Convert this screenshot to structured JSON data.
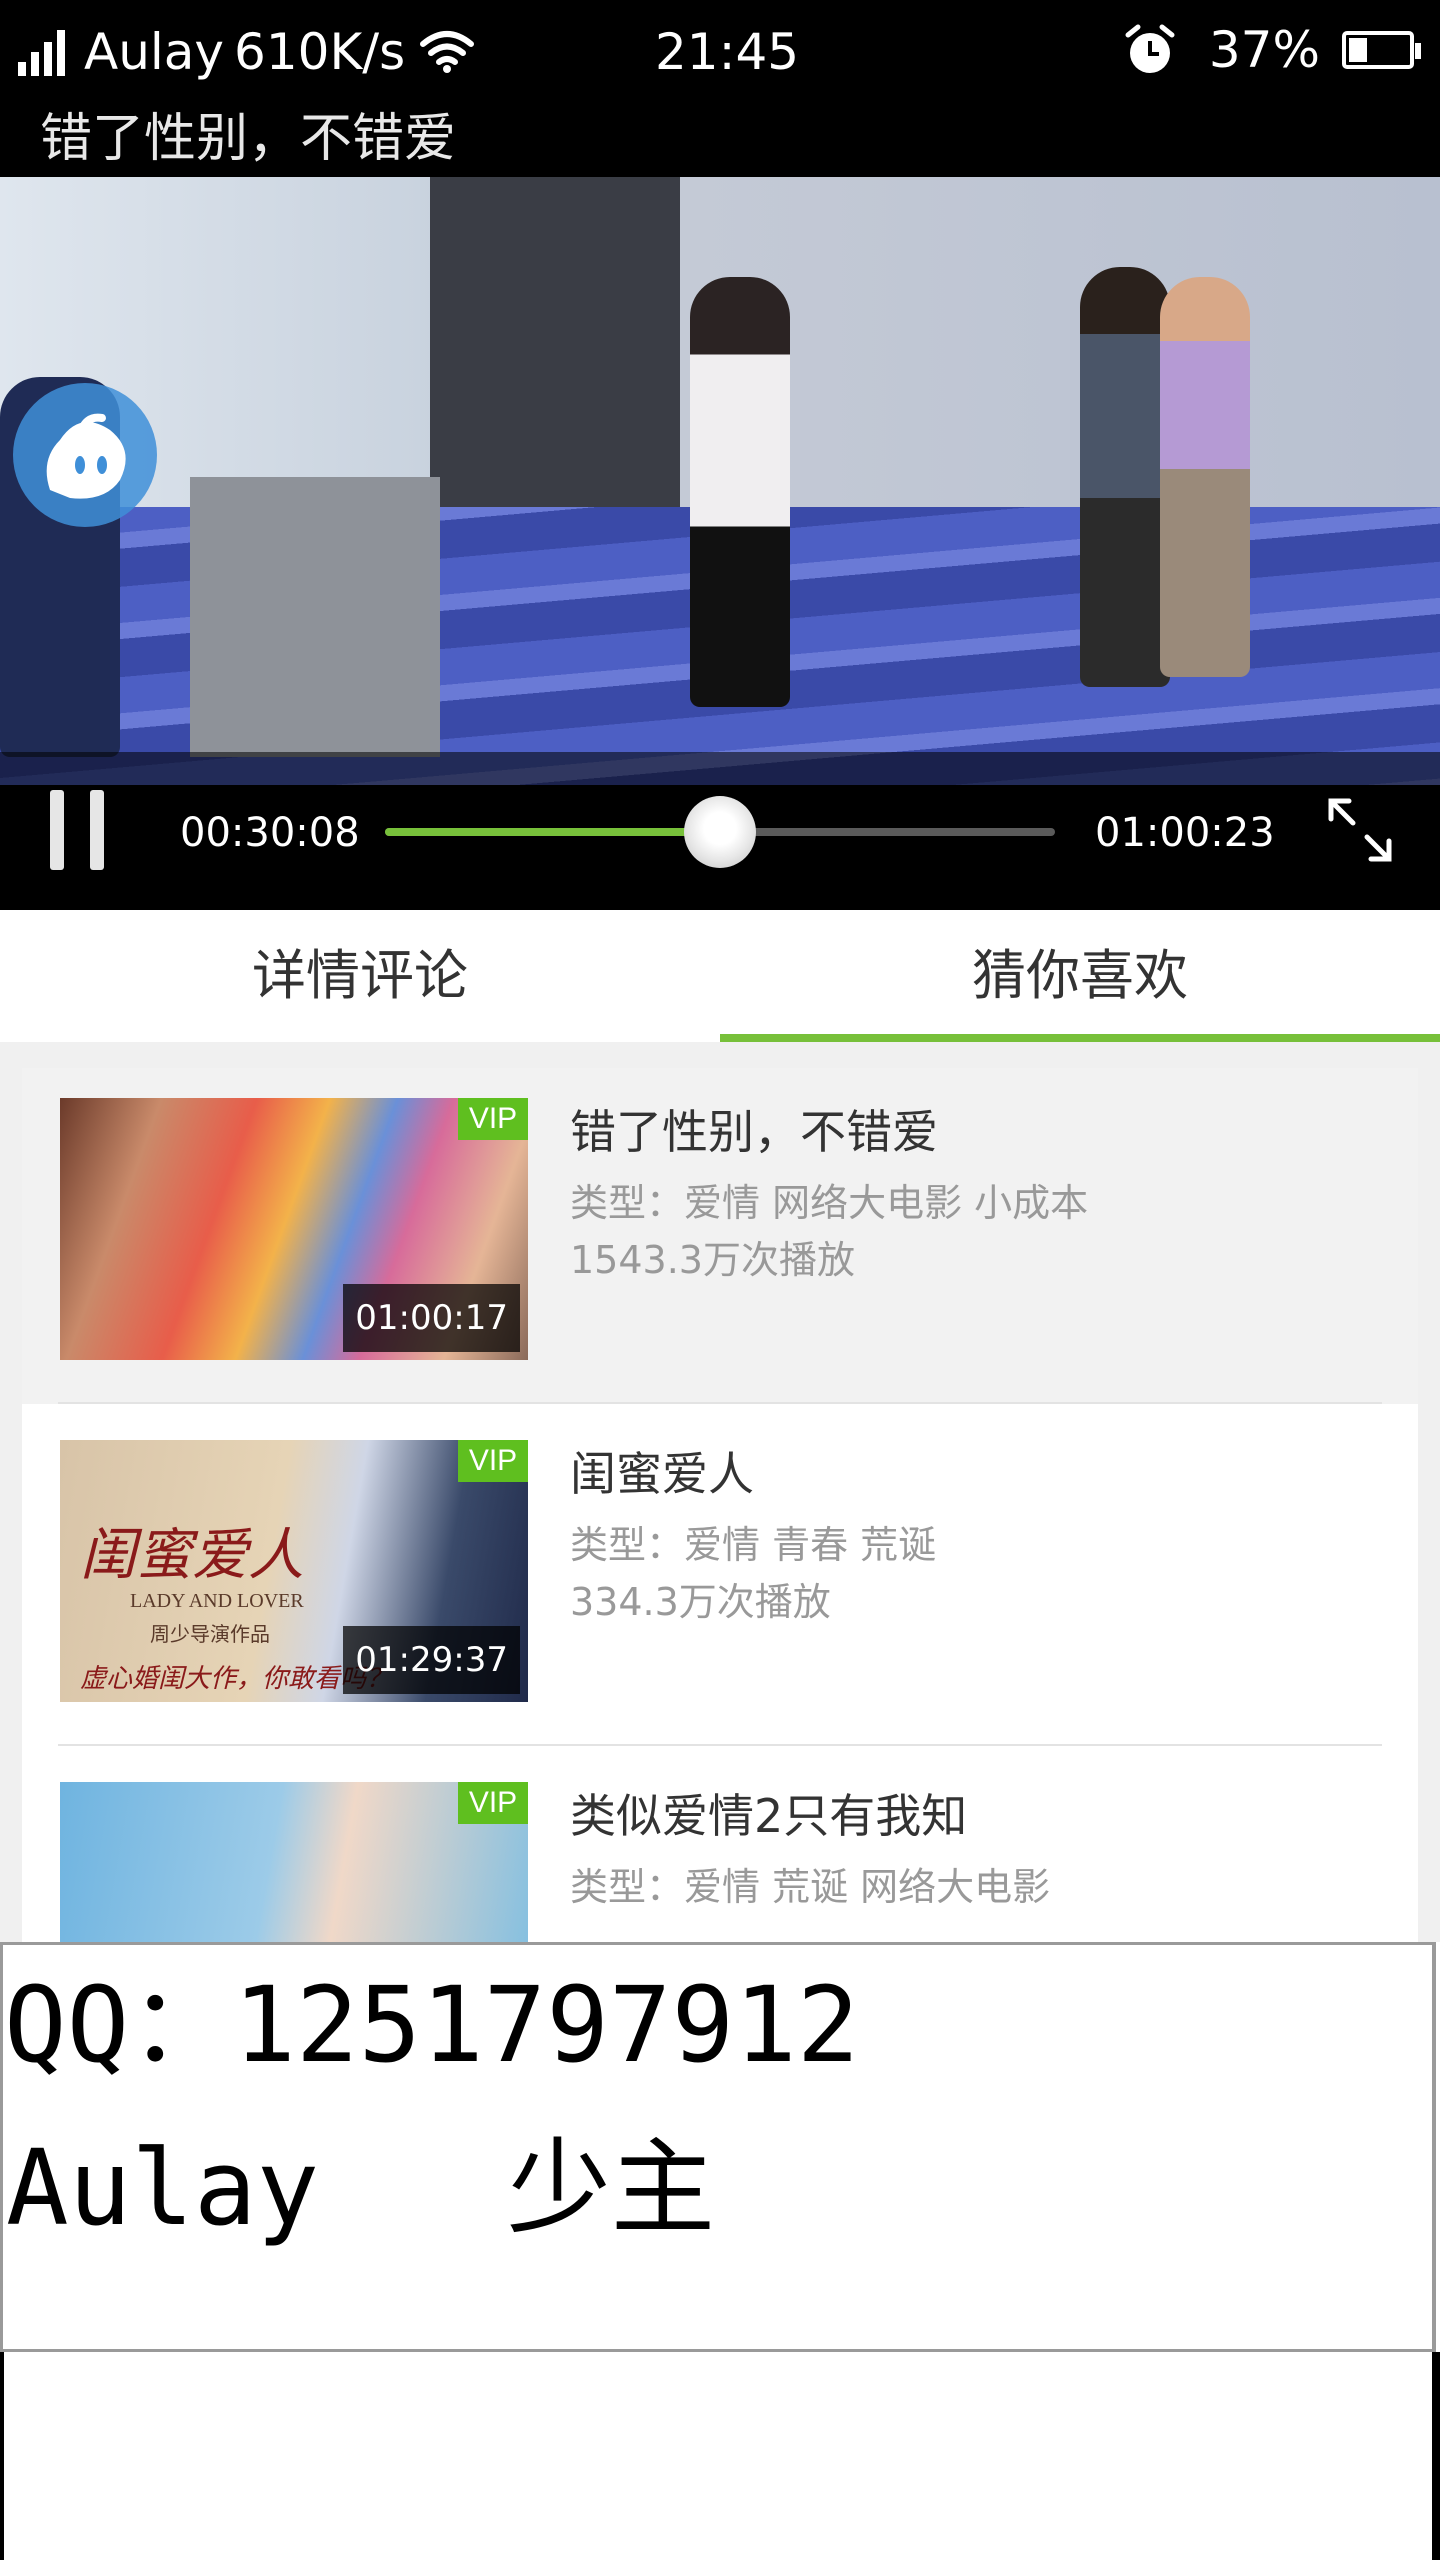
{
  "status_bar": {
    "carrier": "Aulay",
    "speed": "610K/s",
    "time": "21:45",
    "battery_percent": "37%",
    "battery_level": 0.37
  },
  "player": {
    "title": "错了性别，不错爱",
    "current_time": "00:30:08",
    "total_time": "01:00:23",
    "progress": 0.5,
    "accent_color": "#77c03a"
  },
  "tabs": [
    {
      "label": "详情评论",
      "active": false
    },
    {
      "label": "猜你喜欢",
      "active": true
    }
  ],
  "recommendations": [
    {
      "title": "错了性别，不错爱",
      "type": "类型：爱情 网络大电影 小成本",
      "plays": "1543.3万次播放",
      "duration": "01:00:17",
      "badge": "VIP"
    },
    {
      "title": "闺蜜爱人",
      "type": "类型：爱情 青春 荒诞",
      "plays": "334.3万次播放",
      "duration": "01:29:37",
      "badge": "VIP",
      "poster_title": "闺蜜爱人",
      "poster_en": "LADY AND LOVER",
      "poster_sub": "周少导演作品",
      "poster_tag": "虚心婚闺大作，你敢看吗？"
    },
    {
      "title": "类似爱情2只有我知",
      "type": "类型：爱情 荒诞 网络大电影",
      "badge": "VIP"
    }
  ],
  "watermark": {
    "qq_line": "QQ：1251797912",
    "name_line": "Aulay   少主"
  },
  "icons": [
    "signal-icon",
    "wifi-icon",
    "alarm-icon",
    "battery-icon",
    "pause-icon",
    "fullscreen-icon",
    "bubble-logo-icon"
  ]
}
